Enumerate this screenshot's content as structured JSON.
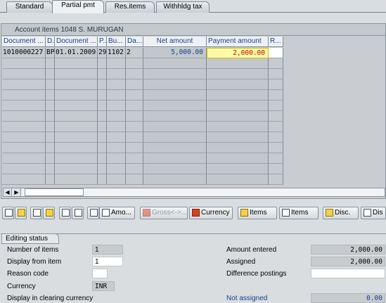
{
  "tabs": [
    {
      "label": "Standard",
      "active": false
    },
    {
      "label": "Partial pmt",
      "active": true
    },
    {
      "label": "Res.items",
      "active": false
    },
    {
      "label": "Withhldg tax",
      "active": false
    }
  ],
  "table": {
    "title": "Account items 1048 S. MURUGAN",
    "headers": [
      "Document ...",
      "D...",
      "Document ...",
      "P...",
      "Bu...",
      "Da...",
      "Net amount",
      "Payment amount",
      "R..."
    ],
    "rows": [
      [
        "1010000227",
        "BP",
        "01.01.2009",
        "29",
        "1102",
        "2",
        "5,000.00",
        "2,000.00",
        ""
      ]
    ]
  },
  "scroll": {
    "left": "◀",
    "right": "▶"
  },
  "toolbar": {
    "amount_label": "Amo...",
    "gross_label": "Gross<->...",
    "currency_label": "Currency",
    "items_label_1": "Items",
    "items_label_2": "Items",
    "disc_label_1": "Disc.",
    "disc_label_2": "Dis"
  },
  "status": {
    "title": "Editing status",
    "number_of_items_label": "Number of items",
    "number_of_items": "1",
    "display_from_item_label": "Display from item",
    "display_from_item": "1",
    "reason_code_label": "Reason code",
    "reason_code": "",
    "currency_label": "Currency",
    "currency": "INR",
    "display_clearing_label": "Display in clearing currency",
    "amount_entered_label": "Amount entered",
    "amount_entered": "2,000.00",
    "assigned_label": "Assigned",
    "assigned": "2,000.00",
    "difference_label": "Difference postings",
    "difference": "",
    "not_assigned_label": "Not assigned",
    "not_assigned": "0.00"
  }
}
